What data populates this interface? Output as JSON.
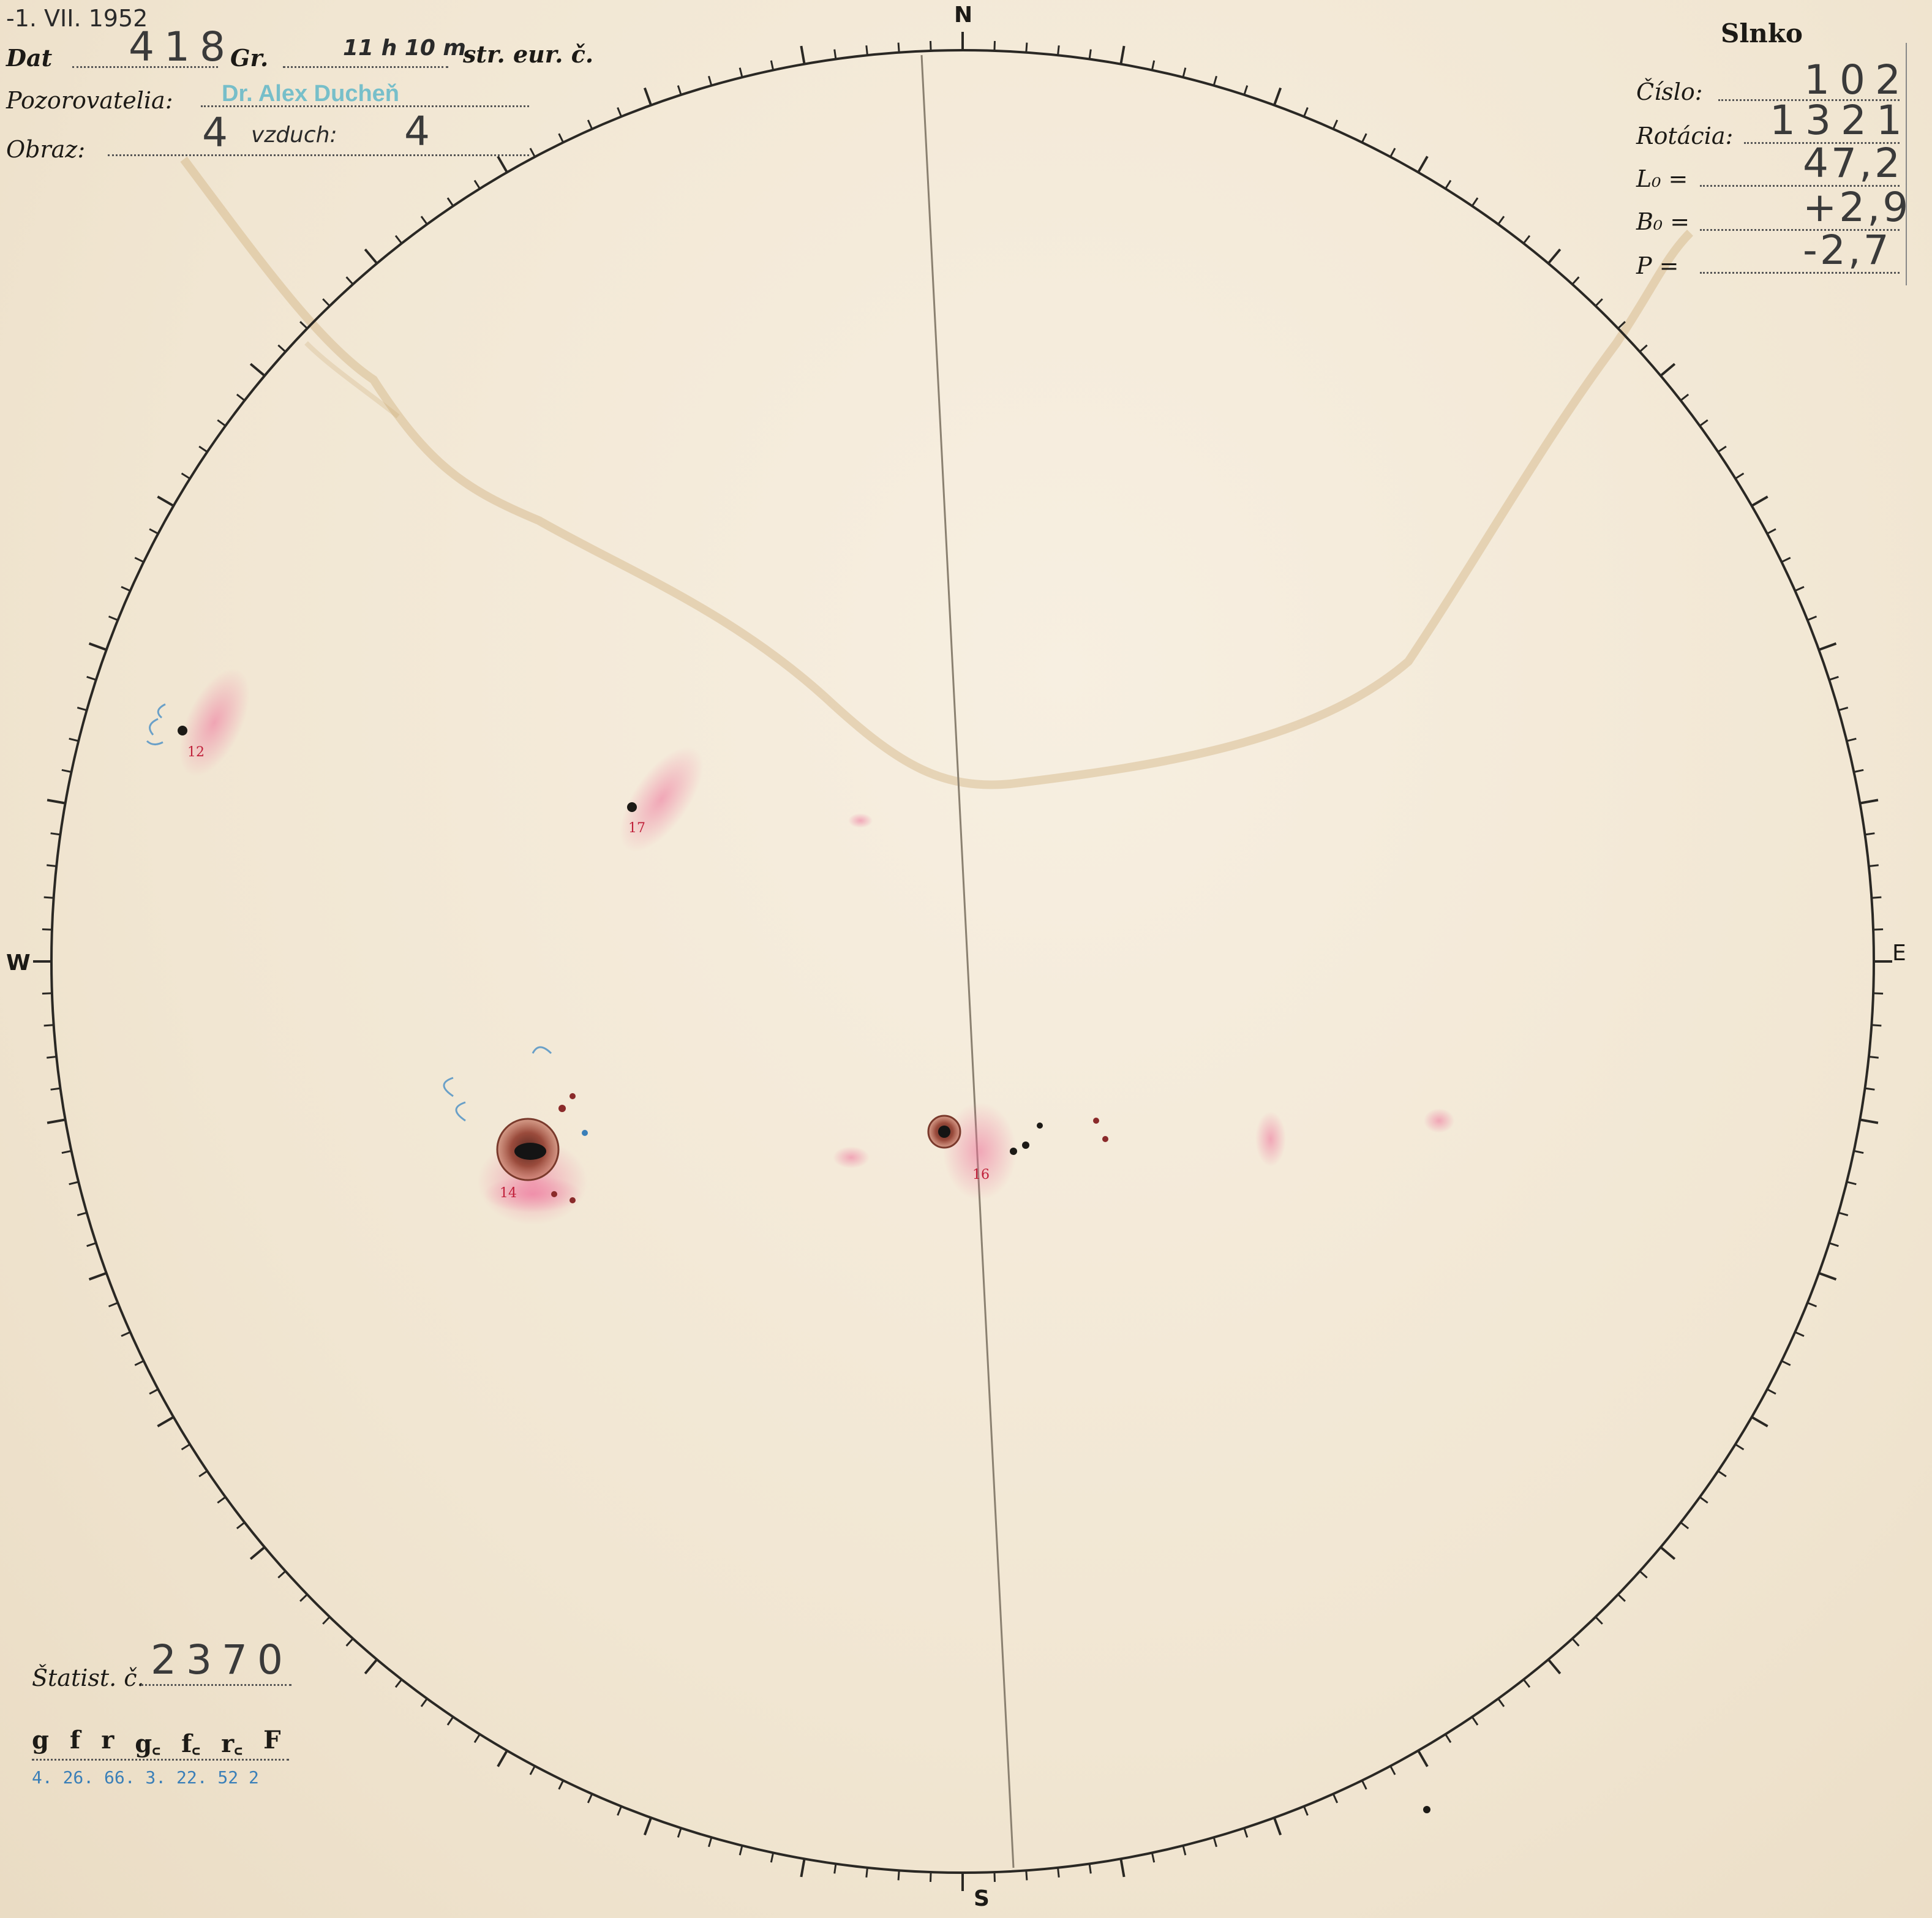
{
  "corner_date": "-1. VII. 1952",
  "form": {
    "dat_label": "Dat",
    "dat_value": "418",
    "gr_label": "Gr.",
    "time_value": "11 h 10 m",
    "time_suffix": "str. eur. č.",
    "observers_label": "Pozorovatelia:",
    "observers_value": "Dr. Alex Ducheň",
    "image_label": "Obraz:",
    "image_value": "4",
    "air_label": "vzduch:",
    "air_value": "4"
  },
  "sun_box": {
    "title": "Slnko",
    "cislo_label": "Číslo:",
    "cislo_value": "102",
    "rotacia_label": "Rotácia:",
    "rotacia_value": "1321",
    "l0_label": "L₀ =",
    "l0_value": "47,2",
    "b0_label": "B₀ =",
    "b0_value": "+2,9",
    "p_label": "P =",
    "p_value": "-2,7"
  },
  "compass": {
    "north": "N",
    "south": "S",
    "west": "W",
    "east": "E"
  },
  "groups": [
    {
      "number": "12"
    },
    {
      "number": "17"
    },
    {
      "number": "14"
    },
    {
      "number": "16"
    }
  ],
  "stats": {
    "label": "Štatist. č.",
    "value": "2370",
    "headers": [
      "g",
      "f",
      "r",
      "g꜀",
      "f꜀",
      "r꜀",
      "F"
    ],
    "values_line": "4. 26. 66. 3. 22. 52  2"
  },
  "colors": {
    "paper": "#f4ead9",
    "stain": "#c9a36a",
    "faculae": "#ee6f9a",
    "ink": "#1c1a16",
    "stamp": "#4fb2c7"
  }
}
